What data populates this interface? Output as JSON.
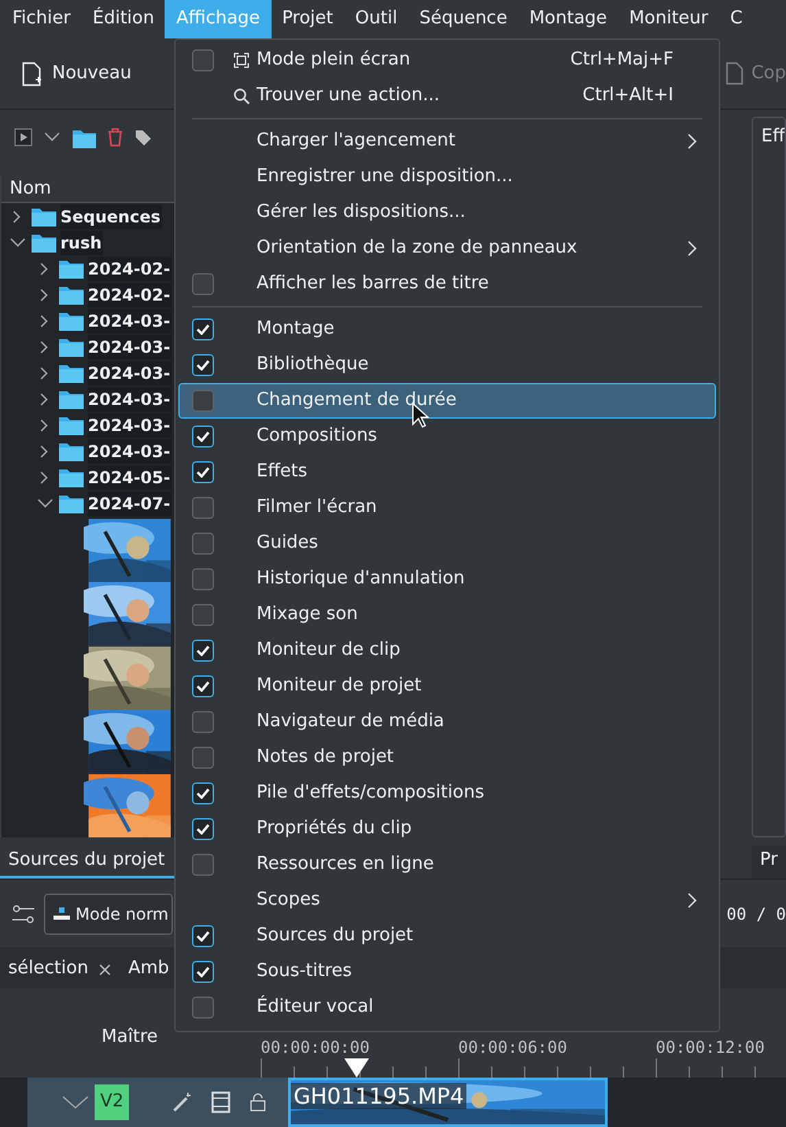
{
  "menubar": [
    {
      "label": "Fichier",
      "selected": false
    },
    {
      "label": "Édition",
      "selected": false
    },
    {
      "label": "Affichage",
      "selected": true
    },
    {
      "label": "Projet",
      "selected": false
    },
    {
      "label": "Outil",
      "selected": false
    },
    {
      "label": "Séquence",
      "selected": false
    },
    {
      "label": "Montage",
      "selected": false
    },
    {
      "label": "Moniteur",
      "selected": false
    },
    {
      "label": "C",
      "selected": false
    }
  ],
  "toolbar": [
    {
      "label": "Nouveau"
    },
    {
      "label": "Cop"
    }
  ],
  "project_bin": {
    "header": "Nom",
    "tree": [
      {
        "label": "Sequences",
        "expanded": false
      },
      {
        "label": "rush",
        "expanded": true,
        "children": [
          {
            "label": "2024-02-",
            "expanded": false
          },
          {
            "label": "2024-02-",
            "expanded": false
          },
          {
            "label": "2024-03-",
            "expanded": false
          },
          {
            "label": "2024-03-",
            "expanded": false
          },
          {
            "label": "2024-03-",
            "expanded": false
          },
          {
            "label": "2024-03-",
            "expanded": false
          },
          {
            "label": "2024-03-",
            "expanded": false
          },
          {
            "label": "2024-03-",
            "expanded": false
          },
          {
            "label": "2024-05-",
            "expanded": false
          },
          {
            "label": "2024-07-",
            "expanded": true
          }
        ]
      }
    ]
  },
  "right_panel": {
    "title": "Eff"
  },
  "dock_tabs": [
    {
      "label": "Sources du projet",
      "selected": true
    },
    {
      "label": "Pr",
      "selected": false
    }
  ],
  "timeline_toolbar": {
    "mode": "Mode norm",
    "timecode": "00 / 0"
  },
  "timeline_tabs": [
    {
      "label": "sélection",
      "selected": false
    },
    {
      "label": "Amb",
      "selected": false
    }
  ],
  "ruler": {
    "track_label": "Maître",
    "timecodes": [
      "00:00:00:00",
      "00:00:06:00",
      "00:00:12:00"
    ]
  },
  "track": {
    "name": "V2",
    "clip": "GH011195.MP4"
  },
  "menu": [
    {
      "kind": "check",
      "label": "Mode plein écran",
      "shortcut": "Ctrl+Maj+F",
      "checked": false,
      "highlighted": false
    },
    {
      "kind": "action",
      "label": "Trouver une action...",
      "shortcut": "Ctrl+Alt+I",
      "highlighted": false
    },
    {
      "kind": "separator"
    },
    {
      "kind": "submenu",
      "label": "Charger l'agencement",
      "highlighted": false
    },
    {
      "kind": "action",
      "label": "Enregistrer une disposition...",
      "highlighted": false
    },
    {
      "kind": "action",
      "label": "Gérer les dispositions...",
      "highlighted": false
    },
    {
      "kind": "submenu",
      "label": "Orientation de la zone de panneaux",
      "highlighted": false
    },
    {
      "kind": "check",
      "label": "Afficher les barres de titre",
      "checked": false,
      "highlighted": false
    },
    {
      "kind": "separator"
    },
    {
      "kind": "check",
      "label": "Montage",
      "checked": true,
      "highlighted": false
    },
    {
      "kind": "check",
      "label": "Bibliothèque",
      "checked": true,
      "highlighted": false
    },
    {
      "kind": "check",
      "label": "Changement de durée",
      "checked": false,
      "highlighted": true
    },
    {
      "kind": "check",
      "label": "Compositions",
      "checked": true,
      "highlighted": false
    },
    {
      "kind": "check",
      "label": "Effets",
      "checked": true,
      "highlighted": false
    },
    {
      "kind": "check",
      "label": "Filmer l'écran",
      "checked": false,
      "highlighted": false
    },
    {
      "kind": "check",
      "label": "Guides",
      "checked": false,
      "highlighted": false
    },
    {
      "kind": "check",
      "label": "Historique d'annulation",
      "checked": false,
      "highlighted": false
    },
    {
      "kind": "check",
      "label": "Mixage son",
      "checked": false,
      "highlighted": false
    },
    {
      "kind": "check",
      "label": "Moniteur de clip",
      "checked": true,
      "highlighted": false
    },
    {
      "kind": "check",
      "label": "Moniteur de projet",
      "checked": true,
      "highlighted": false
    },
    {
      "kind": "check",
      "label": "Navigateur de média",
      "checked": false,
      "highlighted": false
    },
    {
      "kind": "check",
      "label": "Notes de projet",
      "checked": false,
      "highlighted": false
    },
    {
      "kind": "check",
      "label": "Pile d'effets/compositions",
      "checked": true,
      "highlighted": false
    },
    {
      "kind": "check",
      "label": "Propriétés du clip",
      "checked": true,
      "highlighted": false
    },
    {
      "kind": "check",
      "label": "Ressources en ligne",
      "checked": false,
      "highlighted": false
    },
    {
      "kind": "submenu",
      "label": "Scopes",
      "highlighted": false
    },
    {
      "kind": "check",
      "label": "Sources du projet",
      "checked": true,
      "highlighted": false
    },
    {
      "kind": "check",
      "label": "Sous-titres",
      "checked": true,
      "highlighted": false
    },
    {
      "kind": "check",
      "label": "Éditeur vocal",
      "checked": false,
      "highlighted": false
    }
  ]
}
